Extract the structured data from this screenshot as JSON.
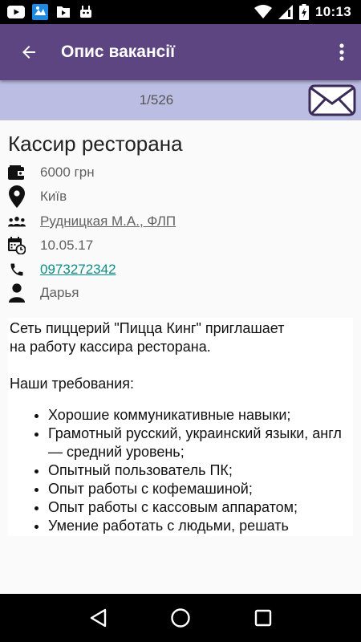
{
  "status_bar": {
    "time": "10:13",
    "icons": [
      "youtube-icon",
      "app-icon",
      "play-store-icon",
      "android-icon",
      "wifi-icon",
      "signal-icon",
      "battery-icon"
    ]
  },
  "app_bar": {
    "title": "Опис вакансії",
    "back_icon": "arrow-left-icon",
    "menu_icon": "more-vert-icon"
  },
  "pager": {
    "text": "1/526",
    "mail_icon": "envelope-icon"
  },
  "job": {
    "title": "Кассир ресторана",
    "salary": "6000 грн",
    "city": "Київ",
    "employer": "Рудницкая М.А., ФЛП",
    "date": "10.05.17",
    "phone": "0973272342",
    "contact": "Дарья"
  },
  "description": {
    "line1": "Сеть пиццерий \"Пицца Кинг\" приглашает",
    "line2": "на работу кассира ресторана.",
    "requirements_heading": "Наши требования:",
    "items": [
      "Хорошие коммуникативные навыки;",
      "Грамотный русский, украинский языки, англ — средний уровень;",
      "Опытный пользователь ПК;",
      "Опыт работы с кофемашиной;",
      "Опыт работы с кассовым аппаратом;",
      "Умение работать с людьми, решать"
    ]
  },
  "colors": {
    "app_bar": "#5d4582",
    "pager_bar": "#bcbde3",
    "link_teal": "#0a8f86"
  }
}
